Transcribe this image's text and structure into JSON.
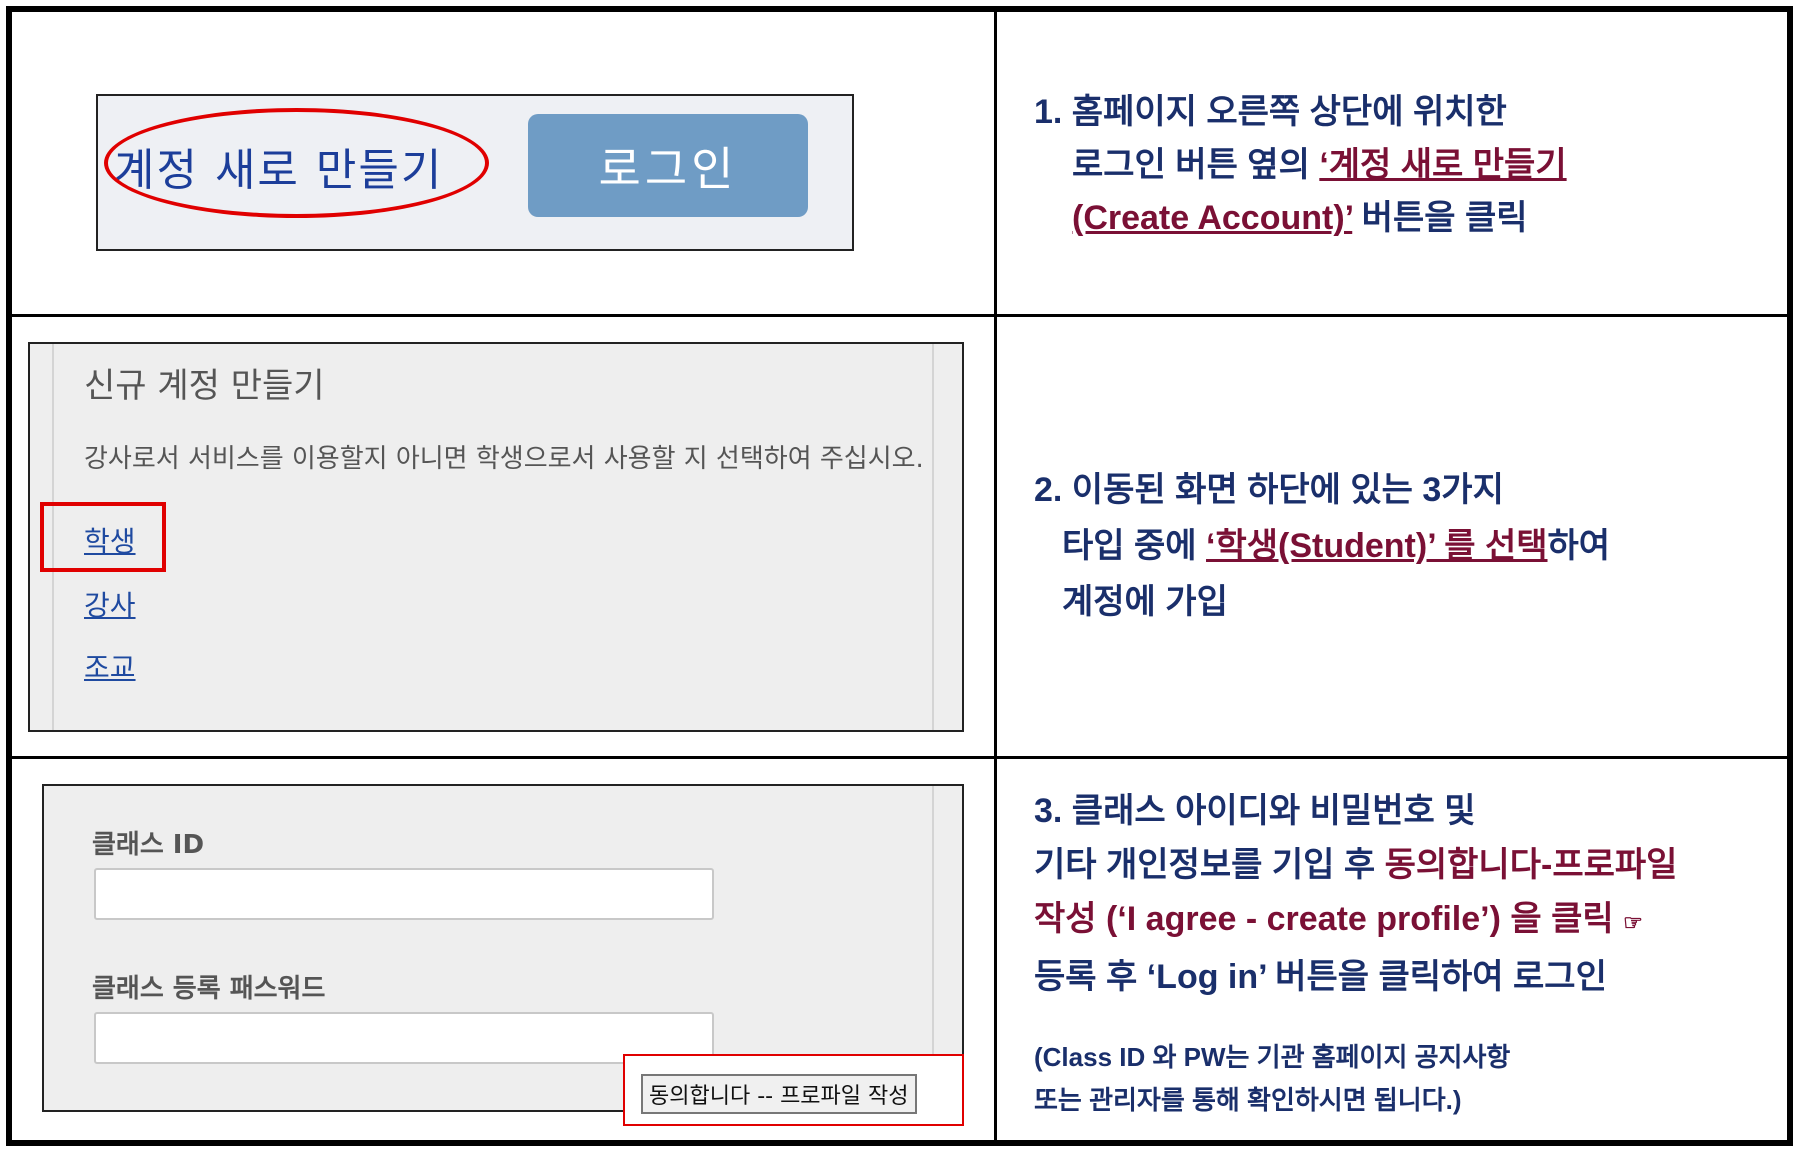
{
  "row1": {
    "create_account_link": "계정 새로 만들기",
    "login_button": "로그인",
    "instruction": {
      "line1": "1. 홈페이지 오른쪽 상단에 위치한",
      "line2_plain": "로그인 버튼 옆의 ",
      "line2_highlight": "‘계정 새로 만들기",
      "line3_highlight": "(Create Account)’",
      "line3_plain": " 버튼을 클릭"
    }
  },
  "row2": {
    "heading": "신규 계정 만들기",
    "description": "강사로서 서비스를 이용할지 아니면 학생으로서 사용할 지 선택하여 주십시오.",
    "roles": [
      "학생",
      "강사",
      "조교"
    ],
    "instruction": {
      "line1": "2. 이동된 화면 하단에 있는 3가지",
      "line2_plain_a": "타입 중에 ",
      "line2_highlight": "‘학생(Student)’ 를 선택",
      "line2_plain_b": "하여",
      "line3": "계정에 가입"
    }
  },
  "row3": {
    "class_id_label": "클래스 ID",
    "class_id_value": "",
    "class_password_label": "클래스 등록 패스워드",
    "class_password_value": "",
    "agree_button": "동의합니다 -- 프로파일 작성",
    "instruction": {
      "line1": "3. 클래스 아이디와  비밀번호 및",
      "line2_plain": "기타 개인정보를 기입 후 ",
      "line2_highlight": "동의합니다-프로파일",
      "line3_highlight": "작성 (‘I agree - create profile’) 을 클릭",
      "line3_icon": "☞",
      "line4": "등록 후 ‘Log in’ 버튼을 클릭하여 로그인",
      "note1": "(Class ID 와 PW는 기관 홈페이지 공지사항",
      "note2": "또는 관리자를 통해 확인하시면 됩니다.)"
    }
  },
  "colors": {
    "instruction_text": "#1a2f6b",
    "highlight_text": "#7a1035",
    "callout_red": "#e00000",
    "login_button_bg": "#6f9cc5",
    "link_blue": "#1f4aa0"
  }
}
